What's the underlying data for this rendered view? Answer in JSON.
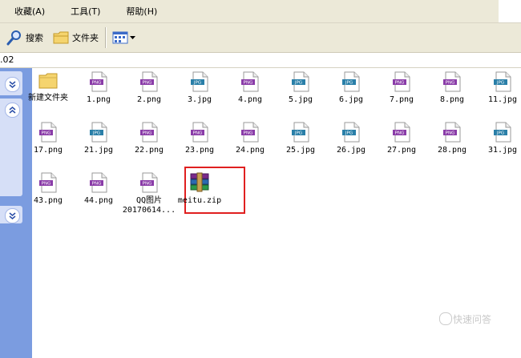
{
  "menu": {
    "items": [
      "收藏(A)",
      "工具(T)",
      "帮助(H)"
    ]
  },
  "toolbar": {
    "search_label": "搜索",
    "folders_label": "文件夹"
  },
  "address": {
    "text": ".02"
  },
  "files": [
    {
      "name": "新建文件夹",
      "type": "folder"
    },
    {
      "name": "1.png",
      "type": "PNG"
    },
    {
      "name": "2.png",
      "type": "PNG"
    },
    {
      "name": "3.jpg",
      "type": "JPG"
    },
    {
      "name": "4.png",
      "type": "PNG"
    },
    {
      "name": "5.jpg",
      "type": "JPG"
    },
    {
      "name": "6.jpg",
      "type": "JPG"
    },
    {
      "name": "7.png",
      "type": "PNG"
    },
    {
      "name": "8.png",
      "type": "PNG"
    },
    {
      "name": "11.jpg",
      "type": "JPG"
    },
    {
      "name": "17.png",
      "type": "PNG"
    },
    {
      "name": "21.jpg",
      "type": "JPG"
    },
    {
      "name": "22.png",
      "type": "PNG"
    },
    {
      "name": "23.png",
      "type": "PNG"
    },
    {
      "name": "24.png",
      "type": "PNG"
    },
    {
      "name": "25.jpg",
      "type": "JPG"
    },
    {
      "name": "26.jpg",
      "type": "JPG"
    },
    {
      "name": "27.png",
      "type": "PNG"
    },
    {
      "name": "28.png",
      "type": "PNG"
    },
    {
      "name": "31.jpg",
      "type": "JPG"
    },
    {
      "name": "43.png",
      "type": "PNG"
    },
    {
      "name": "44.png",
      "type": "PNG"
    },
    {
      "name": "QQ图片\n20170614...",
      "type": "PNG"
    },
    {
      "name": "meitu.zip",
      "type": "zip"
    }
  ],
  "watermark": {
    "text": "快速问答"
  }
}
